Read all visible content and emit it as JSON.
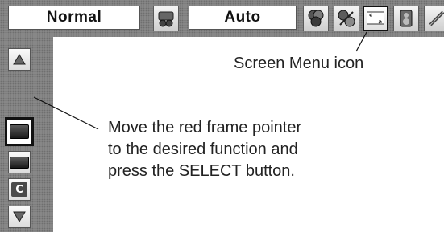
{
  "menu_bar": {
    "mode_value": "Normal",
    "auto_value": "Auto",
    "icons": [
      "settings-icon",
      "image-adjust-icon",
      "color-adjust-icon",
      "screen-menu-icon",
      "sound-icon",
      "setting-tools-icon"
    ]
  },
  "sidebar": {
    "buttons": [
      "up-arrow-icon",
      "normal-screen-icon",
      "full-screen-icon",
      "custom-c-icon",
      "down-arrow-icon"
    ],
    "custom_letter": "C"
  },
  "annotations": {
    "screen_menu_icon": "Screen Menu icon",
    "instruction_line1": "Move the red frame pointer",
    "instruction_line2": "to the desired function and",
    "instruction_line3": "press the SELECT button."
  },
  "colors": {
    "panel": "#8c8c8c",
    "frame": "#111111"
  }
}
